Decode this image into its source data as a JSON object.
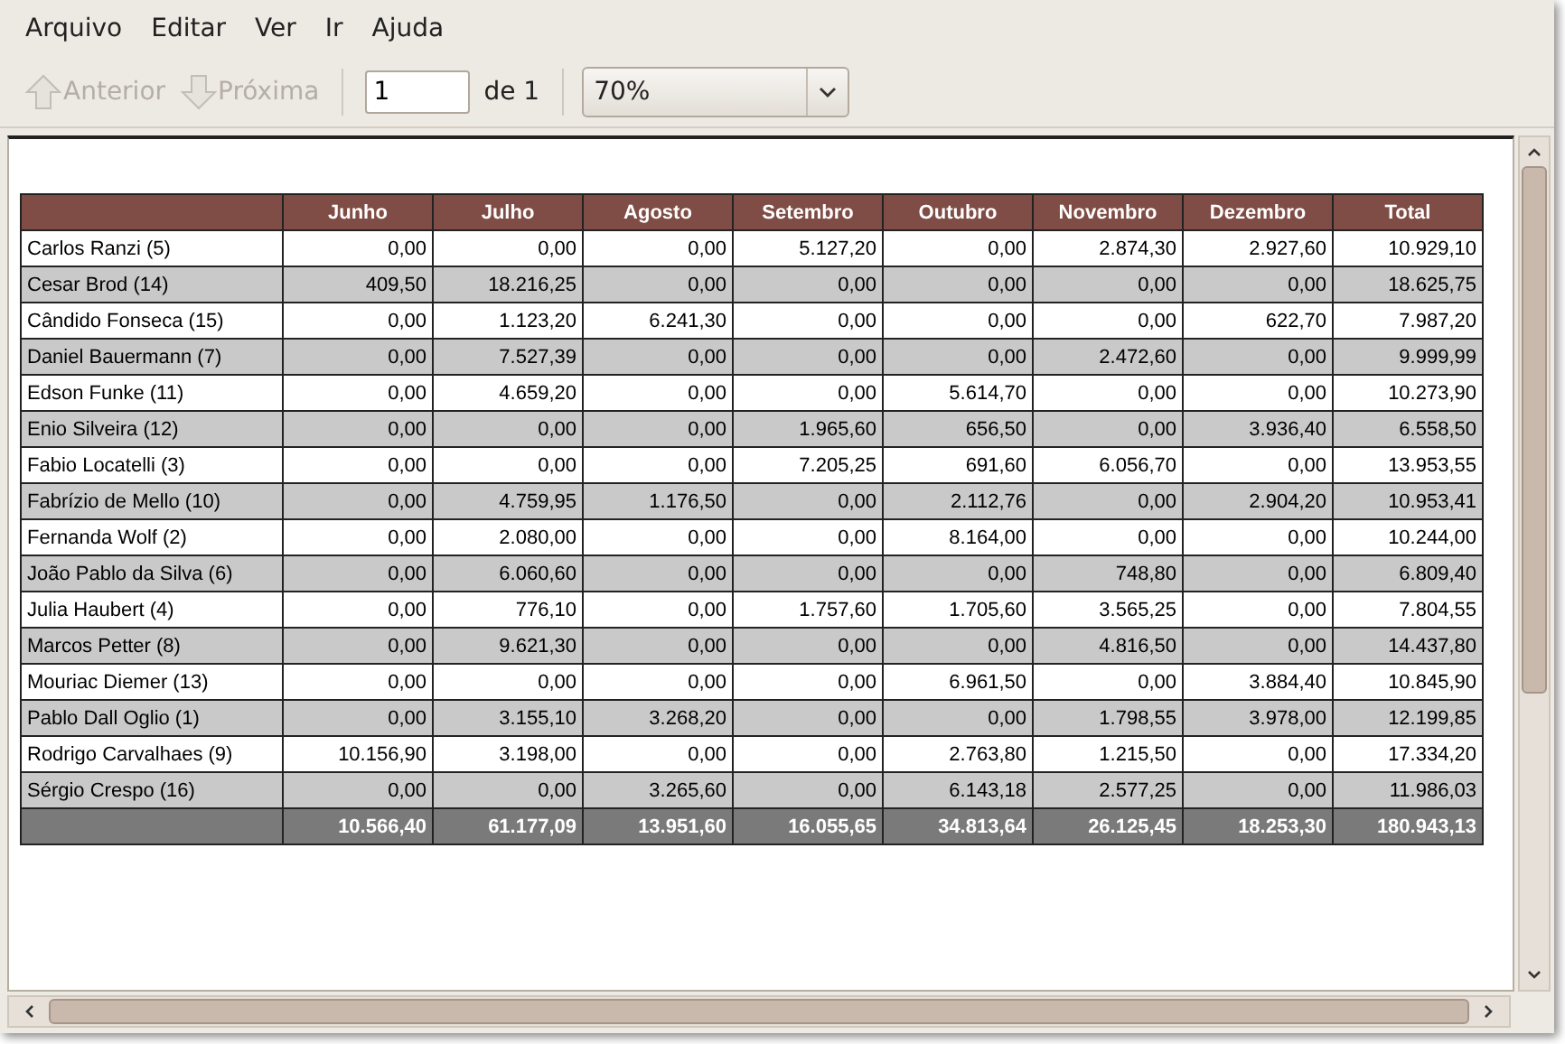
{
  "menu": [
    "Arquivo",
    "Editar",
    "Ver",
    "Ir",
    "Ajuda"
  ],
  "toolbar": {
    "previous": {
      "label": "Anterior",
      "disabled": true
    },
    "next": {
      "label": "Próxima",
      "disabled": true
    },
    "page": {
      "value": "1"
    },
    "page_count": "de 1",
    "zoom": {
      "value": "70%"
    }
  },
  "table": {
    "columns": [
      "",
      "Junho",
      "Julho",
      "Agosto",
      "Setembro",
      "Outubro",
      "Novembro",
      "Dezembro",
      "Total"
    ],
    "rows": [
      [
        "Carlos Ranzi (5)",
        "0,00",
        "0,00",
        "0,00",
        "5.127,20",
        "0,00",
        "2.874,30",
        "2.927,60",
        "10.929,10"
      ],
      [
        "Cesar Brod (14)",
        "409,50",
        "18.216,25",
        "0,00",
        "0,00",
        "0,00",
        "0,00",
        "0,00",
        "18.625,75"
      ],
      [
        "Cândido Fonseca (15)",
        "0,00",
        "1.123,20",
        "6.241,30",
        "0,00",
        "0,00",
        "0,00",
        "622,70",
        "7.987,20"
      ],
      [
        "Daniel Bauermann (7)",
        "0,00",
        "7.527,39",
        "0,00",
        "0,00",
        "0,00",
        "2.472,60",
        "0,00",
        "9.999,99"
      ],
      [
        "Edson Funke (11)",
        "0,00",
        "4.659,20",
        "0,00",
        "0,00",
        "5.614,70",
        "0,00",
        "0,00",
        "10.273,90"
      ],
      [
        "Enio Silveira (12)",
        "0,00",
        "0,00",
        "0,00",
        "1.965,60",
        "656,50",
        "0,00",
        "3.936,40",
        "6.558,50"
      ],
      [
        "Fabio Locatelli (3)",
        "0,00",
        "0,00",
        "0,00",
        "7.205,25",
        "691,60",
        "6.056,70",
        "0,00",
        "13.953,55"
      ],
      [
        "Fabrízio de Mello (10)",
        "0,00",
        "4.759,95",
        "1.176,50",
        "0,00",
        "2.112,76",
        "0,00",
        "2.904,20",
        "10.953,41"
      ],
      [
        "Fernanda Wolf (2)",
        "0,00",
        "2.080,00",
        "0,00",
        "0,00",
        "8.164,00",
        "0,00",
        "0,00",
        "10.244,00"
      ],
      [
        "João Pablo da Silva (6)",
        "0,00",
        "6.060,60",
        "0,00",
        "0,00",
        "0,00",
        "748,80",
        "0,00",
        "6.809,40"
      ],
      [
        "Julia Haubert (4)",
        "0,00",
        "776,10",
        "0,00",
        "1.757,60",
        "1.705,60",
        "3.565,25",
        "0,00",
        "7.804,55"
      ],
      [
        "Marcos Petter (8)",
        "0,00",
        "9.621,30",
        "0,00",
        "0,00",
        "0,00",
        "4.816,50",
        "0,00",
        "14.437,80"
      ],
      [
        "Mouriac Diemer (13)",
        "0,00",
        "0,00",
        "0,00",
        "0,00",
        "6.961,50",
        "0,00",
        "3.884,40",
        "10.845,90"
      ],
      [
        "Pablo Dall Oglio (1)",
        "0,00",
        "3.155,10",
        "3.268,20",
        "0,00",
        "0,00",
        "1.798,55",
        "3.978,00",
        "12.199,85"
      ],
      [
        "Rodrigo Carvalhaes (9)",
        "10.156,90",
        "3.198,00",
        "0,00",
        "0,00",
        "2.763,80",
        "1.215,50",
        "0,00",
        "17.334,20"
      ],
      [
        "Sérgio Crespo (16)",
        "0,00",
        "0,00",
        "3.265,60",
        "0,00",
        "6.143,18",
        "2.577,25",
        "0,00",
        "11.986,03"
      ]
    ],
    "totals": [
      "10.566,40",
      "61.177,09",
      "13.951,60",
      "16.055,65",
      "34.813,64",
      "26.125,45",
      "18.253,30",
      "180.943,13"
    ]
  }
}
